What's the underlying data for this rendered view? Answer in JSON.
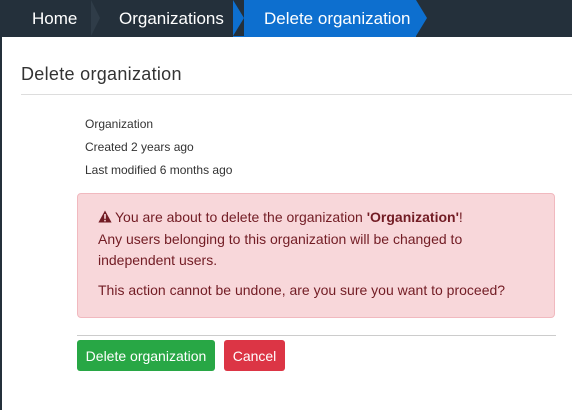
{
  "breadcrumb": {
    "items": [
      {
        "label": "Home"
      },
      {
        "label": "Organizations"
      },
      {
        "label": "Delete organization"
      }
    ]
  },
  "page": {
    "title": "Delete organization"
  },
  "organization": {
    "name": "Organization",
    "created": "Created 2 years ago",
    "modified": "Last modified 6 months ago"
  },
  "alert": {
    "icon": "warning-triangle-icon",
    "prefix": "You are about to delete the organization ",
    "org_quoted": "'Organization'",
    "suffix": "!",
    "message": "Any users belonging to this organization will be changed to independent users.",
    "confirm": "This action cannot be undone, are you sure you want to proceed?",
    "color": "#721c24",
    "background": "#f8d7da"
  },
  "actions": {
    "delete_label": "Delete organization",
    "cancel_label": "Cancel",
    "delete_color": "#28a745",
    "cancel_color": "#dc3545"
  },
  "colors": {
    "nav_bg": "#24303b",
    "active_crumb": "#0d6fcf"
  }
}
